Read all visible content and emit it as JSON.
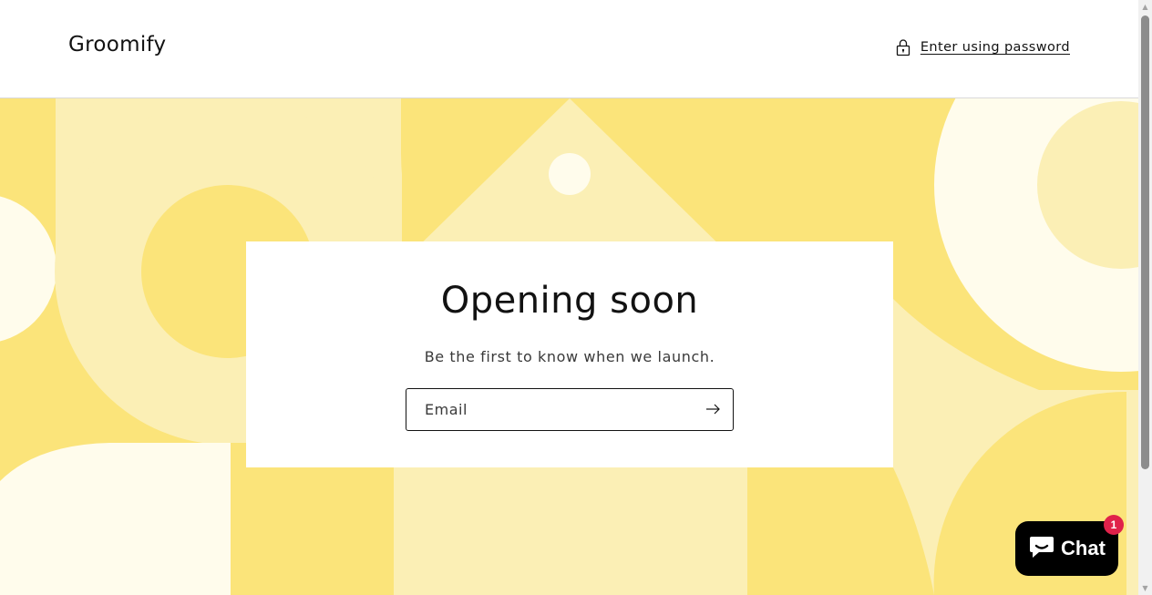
{
  "header": {
    "brand": "Groomify",
    "password_link": "Enter using password",
    "password_icon": "lock-icon"
  },
  "main": {
    "title": "Opening soon",
    "subtitle": "Be the first to know when we launch.",
    "email_placeholder": "Email",
    "submit_icon": "arrow-right-icon"
  },
  "chat": {
    "label": "Chat",
    "badge_count": "1",
    "icon": "chat-bubble-icon"
  },
  "colors": {
    "hero_base": "#fbe47a",
    "hero_light": "#fbefb5",
    "hero_cream": "#fffcec",
    "chat_bg": "#000000",
    "badge": "#e0224a"
  }
}
